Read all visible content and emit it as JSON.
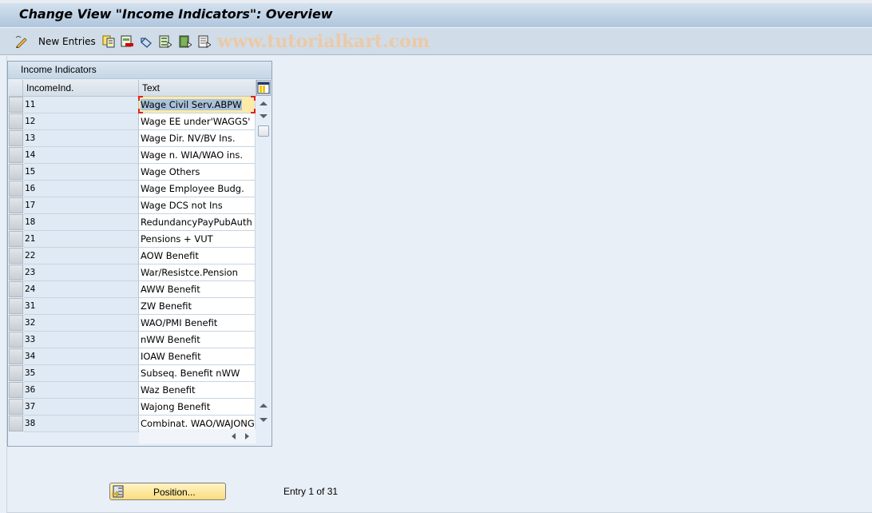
{
  "window": {
    "title": "Change View \"Income Indicators\": Overview"
  },
  "toolbar": {
    "new_entries_label": "New Entries",
    "icons": [
      "edit-pencil-icon",
      "copy-icon",
      "delete-icon",
      "undo-change-icon",
      "select-all-icon",
      "select-block-icon",
      "deselect-all-icon"
    ]
  },
  "watermark": "www.tutorialkart.com",
  "table": {
    "title": "Income Indicators",
    "columns": [
      "IncomeInd.",
      "Text"
    ],
    "rows": [
      {
        "id": "11",
        "text": "Wage Civil Serv.ABPW"
      },
      {
        "id": "12",
        "text": "Wage EE under'WAGGS'"
      },
      {
        "id": "13",
        "text": "Wage Dir. NV/BV Ins."
      },
      {
        "id": "14",
        "text": "Wage n. WIA/WAO ins."
      },
      {
        "id": "15",
        "text": "Wage Others"
      },
      {
        "id": "16",
        "text": "Wage Employee Budg."
      },
      {
        "id": "17",
        "text": "Wage DCS not Ins"
      },
      {
        "id": "18",
        "text": "RedundancyPayPubAuth"
      },
      {
        "id": "21",
        "text": "Pensions + VUT"
      },
      {
        "id": "22",
        "text": "AOW Benefit"
      },
      {
        "id": "23",
        "text": "War/Resistce.Pension"
      },
      {
        "id": "24",
        "text": "AWW Benefit"
      },
      {
        "id": "31",
        "text": "ZW Benefit"
      },
      {
        "id": "32",
        "text": "WAO/PMI Benefit"
      },
      {
        "id": "33",
        "text": "nWW Benefit"
      },
      {
        "id": "34",
        "text": "IOAW Benefit"
      },
      {
        "id": "35",
        "text": "Subseq. Benefit nWW"
      },
      {
        "id": "36",
        "text": "Waz Benefit"
      },
      {
        "id": "37",
        "text": "Wajong Benefit"
      },
      {
        "id": "38",
        "text": "Combinat. WAO/WAJONG"
      }
    ],
    "active_row": 0
  },
  "footer": {
    "position_button_label": "Position...",
    "entry_status": "Entry 1 of 31"
  },
  "colors": {
    "accent_button": "#fbdc7c",
    "focus": "#dd2222",
    "selection": "#a9c1da"
  }
}
